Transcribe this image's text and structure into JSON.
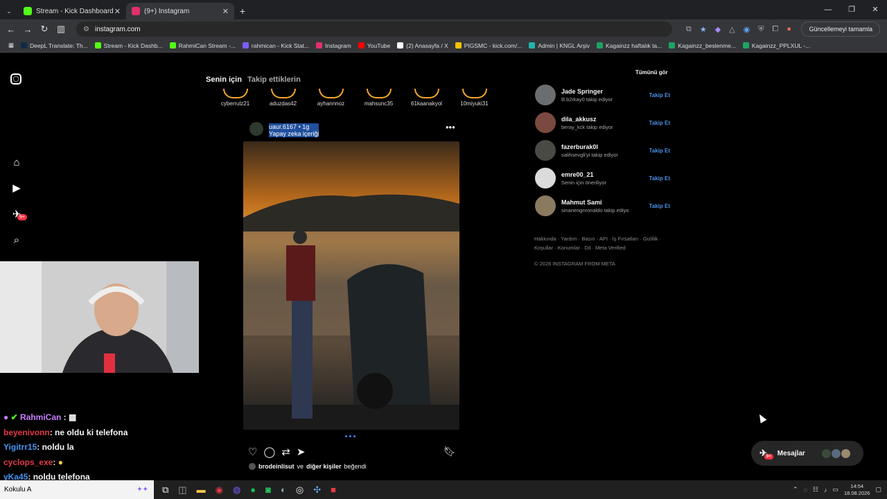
{
  "tabs": [
    {
      "title": "Stream - Kick Dashboard",
      "color": "#53fc18"
    },
    {
      "title": "(9+) Instagram",
      "color": "#e1306c"
    }
  ],
  "address": {
    "url": "instagram.com",
    "update_label": "Güncellemeyi tamamla"
  },
  "bookmarks": [
    {
      "label": "DeepL Translate: Th...",
      "color": "#0f2b46"
    },
    {
      "label": "Stream - Kick Dashb...",
      "color": "#53fc18"
    },
    {
      "label": "RahmiCan Stream -...",
      "color": "#53fc18"
    },
    {
      "label": "rahmican - Kick Stat...",
      "color": "#7c5cff"
    },
    {
      "label": "Instagram",
      "color": "#e1306c"
    },
    {
      "label": "YouTube",
      "color": "#ff0000"
    },
    {
      "label": "(2) Anasayfa / X",
      "color": "#ffffff"
    },
    {
      "label": "PIGSMC - kick.com/...",
      "color": "#f2c200"
    },
    {
      "label": "Admin | KNGL Arşiv",
      "color": "#1fb5ad"
    },
    {
      "label": "Kagainzz haftalık ta...",
      "color": "#1ea362"
    },
    {
      "label": "Kagainzz_beslenme...",
      "color": "#1ea362"
    },
    {
      "label": "Kagainzz_PPLXUL -...",
      "color": "#1ea362"
    }
  ],
  "feed": {
    "tab_active": "Senin için",
    "tab_inactive": "Takip ettiklerin",
    "see_all": "Tümünü gör",
    "stories": [
      "cyberrulz21",
      "aduzdas42",
      "ayhannnoz",
      "mahsunc35",
      "61kaanakyol",
      "10miyuki31"
    ],
    "post": {
      "username": "uaur.6167",
      "dot": "•",
      "age": "1g",
      "subtitle": "Yapay zeka içeriği",
      "more": "•••"
    },
    "likes_user": "brodeinlisut",
    "likes_mid": "ve",
    "likes_others": "diğer kişiler",
    "likes_end": "beğendi"
  },
  "suggestions": [
    {
      "name": "Jade Springer",
      "sub": "lll.b2rkay0 takip ediyor",
      "follow": "Takip Et"
    },
    {
      "name": "dila_akkusz",
      "sub": "beray_kck takip ediyor",
      "follow": "Takip Et"
    },
    {
      "name": "fazerburak0l",
      "sub": "salihsevgli'yi takip ediyor",
      "follow": "Takip Et"
    },
    {
      "name": "emre00_21",
      "sub": "Senin için öneriliyor",
      "follow": "Takip Et"
    },
    {
      "name": "Mahmut Sami",
      "sub": "sinanengnronaldo takip ediyo",
      "follow": "Takip Et"
    }
  ],
  "footer": {
    "links": "Hakkında · Yardım · Basın · API · İş Fırsatları · Gizlilik · Koşullar · Konumlar · Dil · Meta Verified",
    "copyright": "© 2026 INSTAGRAM FROM META"
  },
  "messages": {
    "label": "Mesajlar",
    "badge": "9+"
  },
  "nav_badge": "9+",
  "chat": [
    {
      "user": "RahmiCan",
      "msg": "",
      "color": "#c77dff"
    },
    {
      "user": "beyenivonn",
      "msg": ": ne oldu ki telefona",
      "color": "#e63946"
    },
    {
      "user": "Yigitrr15",
      "msg": ": noldu la",
      "color": "#4895ef"
    },
    {
      "user": "cyclops_exe",
      "msg": ":",
      "color": "#e63946"
    },
    {
      "user": "yKa45",
      "msg": ": noldu telefona",
      "color": "#4895ef"
    }
  ],
  "taskbar": {
    "search_text": "Kokulu A",
    "time": "14:54",
    "date": "18.08.2026"
  }
}
